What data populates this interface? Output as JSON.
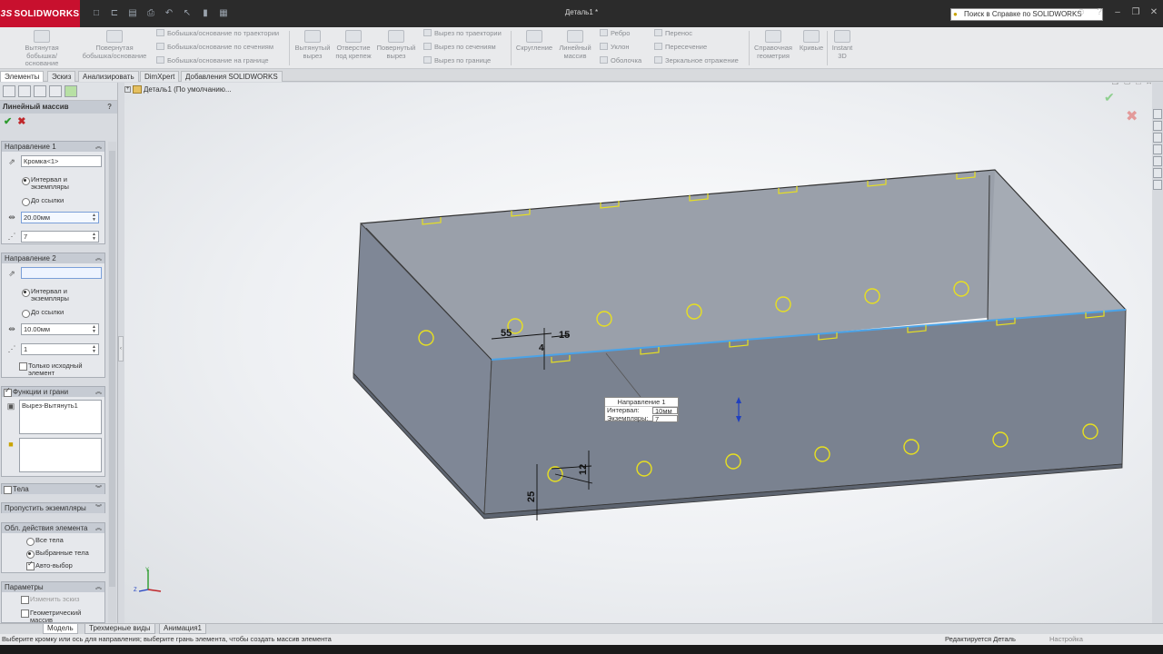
{
  "app": {
    "logo": "SOLIDWORKS",
    "doc_title": "Деталь1 *"
  },
  "help": {
    "placeholder": "Поиск в Справке по SOLIDWORKS"
  },
  "ribbon": {
    "big": [
      "Вытянутая бобышка/основание",
      "Повернутая бобышка/основание",
      "Вытянутый вырез",
      "Отверстие под крепеж",
      "Повернутый вырез",
      "Скругление",
      "Линейный массив",
      "Справочная геометрия",
      "Кривые",
      "Instant 3D"
    ],
    "small": [
      "Бобышка/основание по траектории",
      "Бобышка/основание по сечениям",
      "Бобышка/основание на границе",
      "Вырез по траектории",
      "Вырез по сечениям",
      "Вырез по границе",
      "Ребро",
      "Уклон",
      "Оболочка",
      "Перенос",
      "Пересечение",
      "Зеркальное отражение"
    ]
  },
  "tabs": [
    "Элементы",
    "Эскиз",
    "Анализировать",
    "DimXpert",
    "Добавления SOLIDWORKS"
  ],
  "property_manager": {
    "title": "Линейный массив",
    "help_mark": "?",
    "dir1": {
      "header": "Направление 1",
      "edge": "Кромка<1>",
      "opt_spacing": "Интервал и экземпляры",
      "opt_reference": "До ссылки",
      "spacing": "20.00мм",
      "count": "7"
    },
    "dir2": {
      "header": "Направление 2",
      "edge": "",
      "opt_spacing": "Интервал и экземпляры",
      "opt_reference": "До ссылки",
      "spacing": "10.00мм",
      "count": "1",
      "seed_only": "Только исходный элемент"
    },
    "features": {
      "header": "Функции и грани",
      "item": "Вырез-Вытянуть1"
    },
    "bodies": {
      "header": "Тела"
    },
    "skip": {
      "header": "Пропустить экземпляры"
    },
    "scope": {
      "header": "Обл. действия элемента",
      "all": "Все тела",
      "selected": "Выбранные тела",
      "auto": "Авто-выбор"
    },
    "options": {
      "header": "Параметры",
      "vary_sketch": "Изменить эскиз",
      "geometric": "Геометрический массив"
    }
  },
  "viewport": {
    "tree_item": "Деталь1 (По умолчанию...",
    "callout": {
      "title": "Направление 1",
      "spacing_label": "Интервал:",
      "spacing_value": "10мм",
      "count_label": "Экземпляры:",
      "count_value": "7"
    },
    "dims": [
      "55",
      "15",
      "4",
      "12",
      "25"
    ]
  },
  "bottom_tabs": [
    "Модель",
    "Трехмерные виды",
    "Анимация1"
  ],
  "status": {
    "hint": "Выберите кромку или ось для направления; выберите грань элемента, чтобы создать массив элемента",
    "mode": "Редактируется Деталь",
    "settings": "Настройка"
  },
  "colors": {
    "brand": "#c8102e",
    "model_face": "#7c8492",
    "highlight": "#e8e020",
    "selection": "#4aa3e8"
  }
}
